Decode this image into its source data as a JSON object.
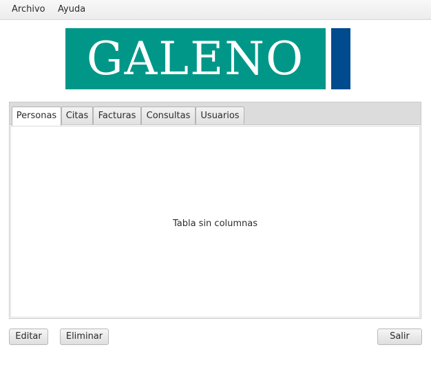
{
  "menubar": {
    "items": [
      {
        "label": "Archivo"
      },
      {
        "label": "Ayuda"
      }
    ]
  },
  "logo": {
    "text": "GALENO",
    "colors": {
      "background": "#009789",
      "stripe": "#004a8e",
      "text": "#ffffff"
    }
  },
  "tabs": [
    {
      "label": "Personas",
      "selected": true
    },
    {
      "label": "Citas",
      "selected": false
    },
    {
      "label": "Facturas",
      "selected": false
    },
    {
      "label": "Consultas",
      "selected": false
    },
    {
      "label": "Usuarios",
      "selected": false
    }
  ],
  "table": {
    "empty_message": "Tabla sin columnas"
  },
  "buttons": {
    "editar": "Editar",
    "eliminar": "Eliminar",
    "salir": "Salir"
  }
}
